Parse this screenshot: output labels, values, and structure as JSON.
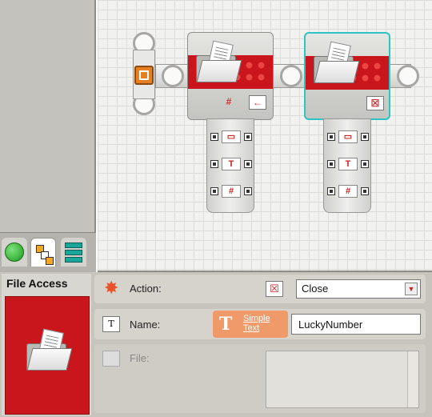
{
  "config": {
    "block_title": "File Access",
    "action": {
      "label": "Action:",
      "value": "Close"
    },
    "name": {
      "label": "Name:",
      "source_link": "Simple Text",
      "value": "LuckyNumber"
    },
    "file": {
      "label": "File:"
    }
  },
  "icons": {
    "action": "star-burst-icon",
    "name": "text-tag-icon",
    "file": "folder-icon",
    "close_action": "close-file-icon"
  },
  "colors": {
    "block_red": "#c8161c",
    "selection": "#2ec4c4",
    "link_orange": "#f09a6a"
  }
}
